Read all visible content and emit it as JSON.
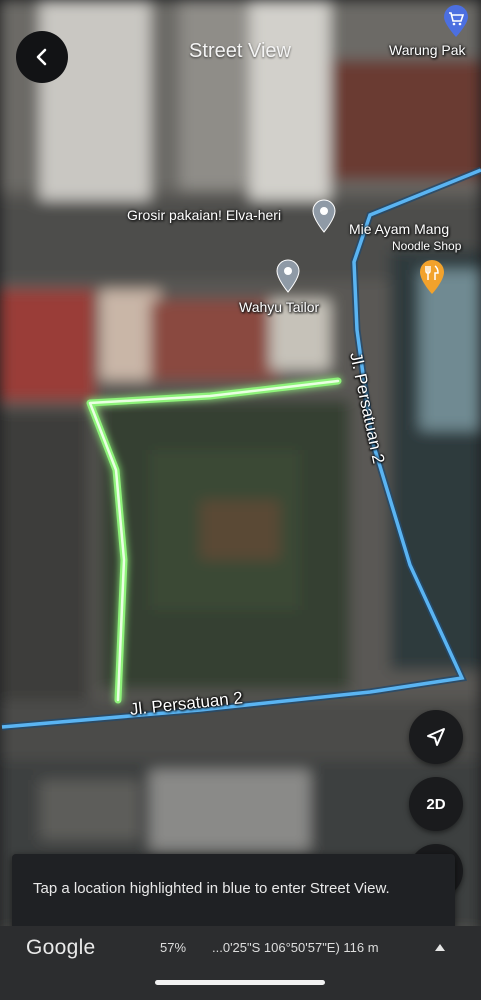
{
  "header": {
    "title": "Street View"
  },
  "map": {
    "places": [
      {
        "name": "Warung Pak",
        "icon": "shopping-cart-icon",
        "color": "#4c6fe0"
      },
      {
        "name": "Grosir pakaian! Elva-heri",
        "icon": "map-pin-icon",
        "color": "#8f9aa6"
      },
      {
        "name": "Mie Ayam Mang",
        "sub": "Noodle Shop",
        "icon": "restaurant-icon",
        "color": "#f2a22c"
      },
      {
        "name": "Wahyu Tailor",
        "icon": "map-pin-icon",
        "color": "#8f9aa6"
      }
    ],
    "streets": {
      "vertical": "Jl. Persatuan 2",
      "horizontal": "Jl. Persatuan 2"
    },
    "colors": {
      "street_view_line": "#5ab4f2",
      "highlight": "#8ef27a"
    }
  },
  "controls": {
    "navigate_icon": "navigation-arrow-icon",
    "toggle_2d_label": "2D"
  },
  "toast": {
    "message": "Tap a location highlighted in blue to enter Street View."
  },
  "footer": {
    "logo": "Google",
    "zoom": "57%",
    "coordinates": "...0'25\"S 106°50'57\"E) 116 m",
    "expand_icon": "caret-up-icon"
  }
}
